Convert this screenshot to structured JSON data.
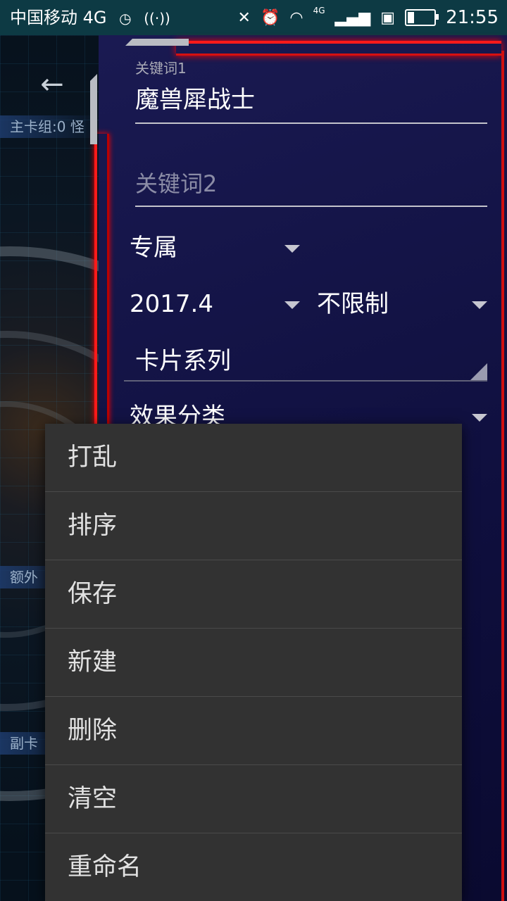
{
  "status_bar": {
    "carrier": "中国移动 4G",
    "network_badge": "4G",
    "time": "21:55",
    "battery_level": 0.25,
    "icons": [
      "timer-icon",
      "hotspot-icon",
      "mute-icon",
      "alarm-icon",
      "wifi-icon",
      "signal-icon",
      "sim-icon",
      "battery-icon"
    ]
  },
  "background": {
    "back_icon": "←",
    "labels": [
      "主卡组:0 怪",
      "额外",
      "副卡"
    ]
  },
  "search_panel": {
    "keyword1": {
      "label": "关键词1",
      "value": "魔兽犀战士"
    },
    "keyword2": {
      "placeholder": "关键词2"
    },
    "limit_filter": "专属",
    "pack_filter": "2017.4",
    "limit_type_filter": "不限制",
    "card_series": "卡片系列",
    "effect_category": "效果分类"
  },
  "menu": {
    "items": [
      "打乱",
      "排序",
      "保存",
      "新建",
      "删除",
      "清空",
      "重命名"
    ]
  },
  "colors": {
    "frame_red": "#ff1a1a",
    "panel_bg": "#14144a",
    "menu_bg": "#323232",
    "status_bar_bg": "#0d3a44"
  }
}
